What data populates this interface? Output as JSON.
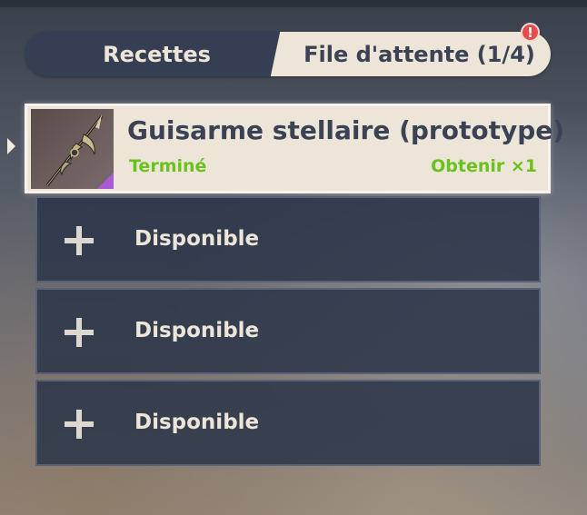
{
  "tabs": {
    "recipes_label": "Recettes",
    "queue_label": "File d'attente (1/4)",
    "alert_badge": "!"
  },
  "queue": {
    "active_item": {
      "name": "Guisarme stellaire (prototype)",
      "status": "Terminé",
      "obtain_label": "Obtenir ×1",
      "icon": "polearm-icon",
      "rarity_color": "#a75bd8"
    },
    "slots": [
      {
        "label": "Disponible",
        "icon": "plus-icon"
      },
      {
        "label": "Disponible",
        "icon": "plus-icon"
      },
      {
        "label": "Disponible",
        "icon": "plus-icon"
      }
    ]
  },
  "colors": {
    "accent_green": "#6ac21c",
    "panel_cream": "#ece5d8",
    "text_dark": "#3b4255",
    "alert_red": "#e64b4b"
  }
}
